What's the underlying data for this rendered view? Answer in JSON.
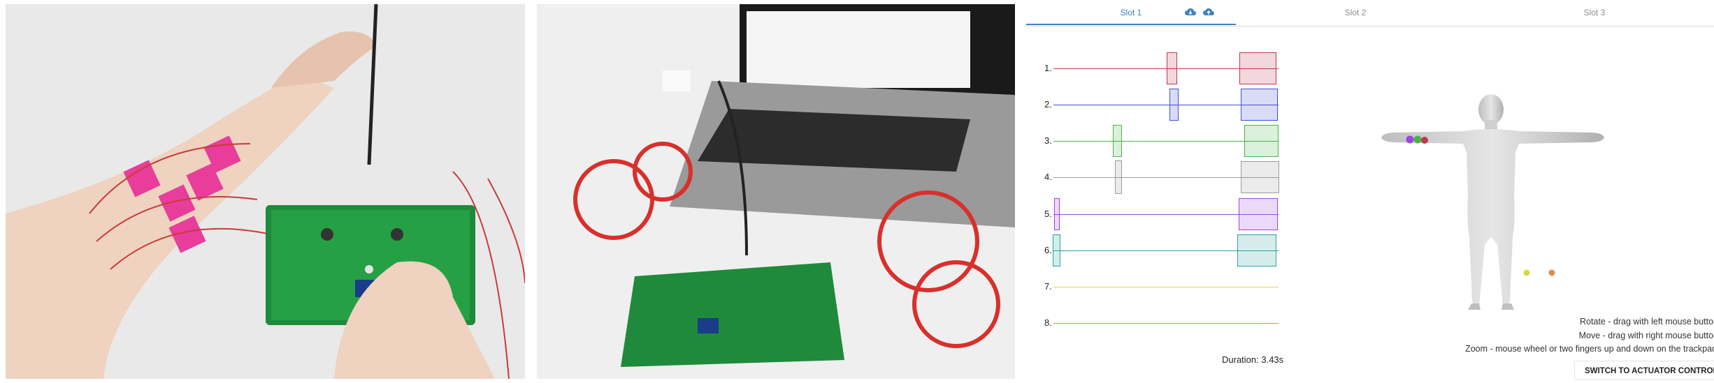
{
  "tabs": [
    {
      "label": "Slot 1",
      "active": true
    },
    {
      "label": "Slot 2",
      "active": false
    },
    {
      "label": "Slot 3",
      "active": false
    }
  ],
  "icons": {
    "download": "cloud-download-icon",
    "upload": "cloud-upload-icon"
  },
  "colors": {
    "accent": "#3b82c4"
  },
  "tracks": [
    {
      "label": "1.",
      "color": "#c0394f"
    },
    {
      "label": "2.",
      "color": "#3d4fd6"
    },
    {
      "label": "3.",
      "color": "#49b447"
    },
    {
      "label": "4.",
      "color": "#9c9c9c"
    },
    {
      "label": "5.",
      "color": "#9b45e0"
    },
    {
      "label": "6.",
      "color": "#2aa3a0"
    },
    {
      "label": "7.",
      "color": "#d6d84a"
    },
    {
      "label": "8.",
      "color": "#dd8a4f"
    }
  ],
  "duration": "Duration: 3.43s",
  "help": {
    "rotate": "Rotate - drag with left mouse button",
    "move": "Move - drag with right mouse button",
    "zoom": "Zoom - mouse wheel or two fingers up and down on the trackpad"
  },
  "switch_button": "SWITCH TO ACTUATOR CONTROL"
}
